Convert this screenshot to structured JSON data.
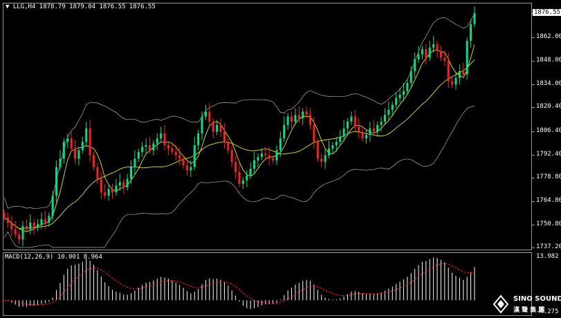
{
  "header": {
    "symbol": "LLG,H4",
    "ohlc": "1878.79 1879.04 1876.55 1876.55"
  },
  "price_axis": {
    "labels": [
      "1876.55",
      "1862.00",
      "1848.00",
      "1834.00",
      "1820.40",
      "1806.40",
      "1792.40",
      "1778.80",
      "1764.80",
      "1750.80",
      "1737.20"
    ]
  },
  "macd": {
    "title": "MACD(12,26,9) 10.001 8.964",
    "axis_labels": [
      "13.982",
      "-4.275"
    ]
  },
  "watermark": {
    "brand_en": "SINO SOUND",
    "brand_cn": "漢 聲 集 團"
  },
  "colors": {
    "bull": "#00e08a",
    "bear": "#ff1e1e",
    "ma": "#e8e800",
    "bands": "#b0b0b0",
    "macd_hist": "#ffffff",
    "macd_signal": "#ff2020"
  },
  "chart_data": [
    {
      "type": "candlestick",
      "title": "LLG,H4",
      "ylim": [
        1737.2,
        1881.0
      ],
      "close": [
        1755,
        1752,
        1748,
        1745,
        1742,
        1750,
        1748,
        1752,
        1749,
        1751,
        1754,
        1752,
        1756,
        1768,
        1785,
        1790,
        1800,
        1802,
        1796,
        1790,
        1795,
        1800,
        1808,
        1792,
        1785,
        1778,
        1770,
        1768,
        1772,
        1770,
        1774,
        1776,
        1773,
        1778,
        1785,
        1790,
        1794,
        1797,
        1798,
        1795,
        1799,
        1802,
        1805,
        1798,
        1796,
        1794,
        1792,
        1790,
        1786,
        1783,
        1785,
        1798,
        1805,
        1815,
        1818,
        1812,
        1806,
        1810,
        1806,
        1800,
        1795,
        1788,
        1782,
        1775,
        1777,
        1780,
        1784,
        1789,
        1791,
        1793,
        1792,
        1790,
        1789,
        1795,
        1802,
        1810,
        1815,
        1812,
        1816,
        1814,
        1818,
        1816,
        1810,
        1800,
        1790,
        1788,
        1792,
        1796,
        1798,
        1800,
        1803,
        1808,
        1812,
        1815,
        1809,
        1806,
        1802,
        1804,
        1808,
        1806,
        1810,
        1812,
        1816,
        1819,
        1822,
        1826,
        1828,
        1830,
        1835,
        1842,
        1849,
        1852,
        1855,
        1850,
        1856,
        1858,
        1854,
        1850,
        1848,
        1836,
        1834,
        1838,
        1842,
        1840,
        1860,
        1870,
        1876.55
      ],
      "ma": "yellow moving average overlay",
      "bollinger_bands": "grey upper/lower bands"
    },
    {
      "type": "bar",
      "title": "MACD(12,26,9) 10.001 8.964",
      "ylim": [
        -4.275,
        13.982
      ],
      "signal_line": "red dashed"
    }
  ]
}
